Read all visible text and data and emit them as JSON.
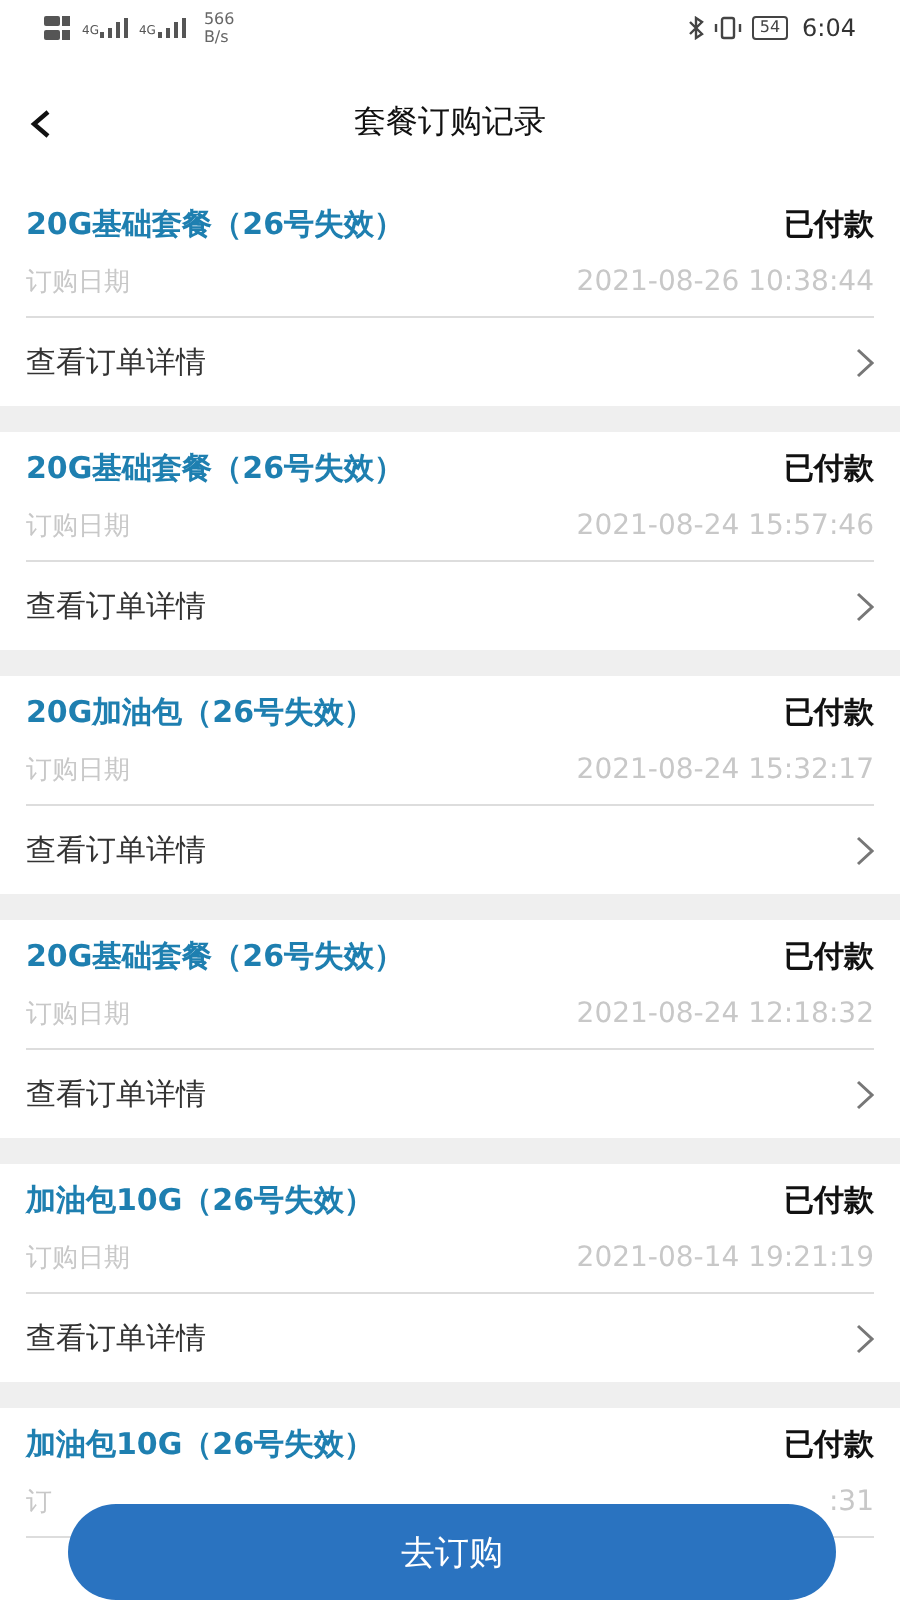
{
  "status_bar": {
    "network": [
      "4G",
      "4G"
    ],
    "speed_value": "566",
    "speed_unit": "B/s",
    "battery": "54",
    "time": "6:04"
  },
  "header": {
    "title": "套餐订购记录"
  },
  "orders": [
    {
      "name": "20G基础套餐（26号失效）",
      "status": "已付款",
      "date_label": "订购日期",
      "date": "2021-08-26 10:38:44",
      "details_link": "查看订单详情"
    },
    {
      "name": "20G基础套餐（26号失效）",
      "status": "已付款",
      "date_label": "订购日期",
      "date": "2021-08-24 15:57:46",
      "details_link": "查看订单详情"
    },
    {
      "name": "20G加油包（26号失效）",
      "status": "已付款",
      "date_label": "订购日期",
      "date": "2021-08-24 15:32:17",
      "details_link": "查看订单详情"
    },
    {
      "name": "20G基础套餐（26号失效）",
      "status": "已付款",
      "date_label": "订购日期",
      "date": "2021-08-24 12:18:32",
      "details_link": "查看订单详情"
    },
    {
      "name": "加油包10G（26号失效）",
      "status": "已付款",
      "date_label": "订购日期",
      "date": "2021-08-14 19:21:19",
      "details_link": "查看订单详情"
    },
    {
      "name": "加油包10G（26号失效）",
      "status": "已付款",
      "date_label": "订",
      "date": ":31"
    }
  ],
  "order_button": {
    "label": "去订购"
  }
}
